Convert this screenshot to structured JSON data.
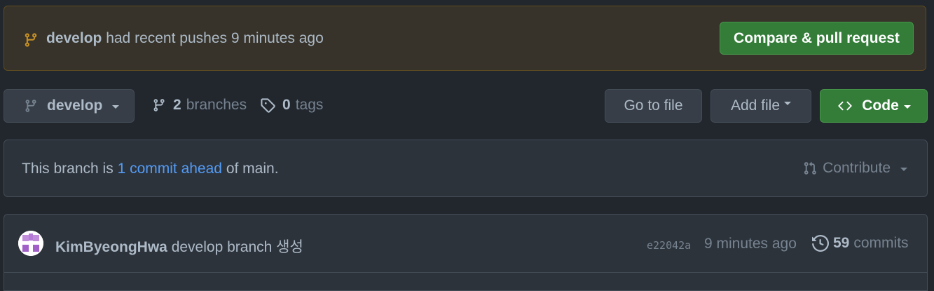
{
  "banner": {
    "branch": "develop",
    "message": "had recent pushes 9 minutes ago",
    "button_label": "Compare & pull request",
    "icon": "git-branch-icon"
  },
  "toolbar": {
    "branch_select": "develop",
    "branches_count": "2",
    "branches_label": "branches",
    "tags_count": "0",
    "tags_label": "tags",
    "goto_label": "Go to file",
    "addfile_label": "Add file",
    "code_label": "Code"
  },
  "ahead": {
    "prefix": "This branch is",
    "link": "1 commit ahead",
    "suffix": "of main.",
    "contribute_label": "Contribute"
  },
  "commit": {
    "author": "KimByeongHwa",
    "message": "develop branch 생성",
    "sha": "e22042a",
    "time": "9 minutes ago",
    "commits_count": "59",
    "commits_label": "commits"
  },
  "colors": {
    "background": "#22272e",
    "banner_bg": "#37332a",
    "accent_green": "#347d39",
    "link_blue": "#539bf5",
    "branch_icon_yellow": "#c69026"
  }
}
